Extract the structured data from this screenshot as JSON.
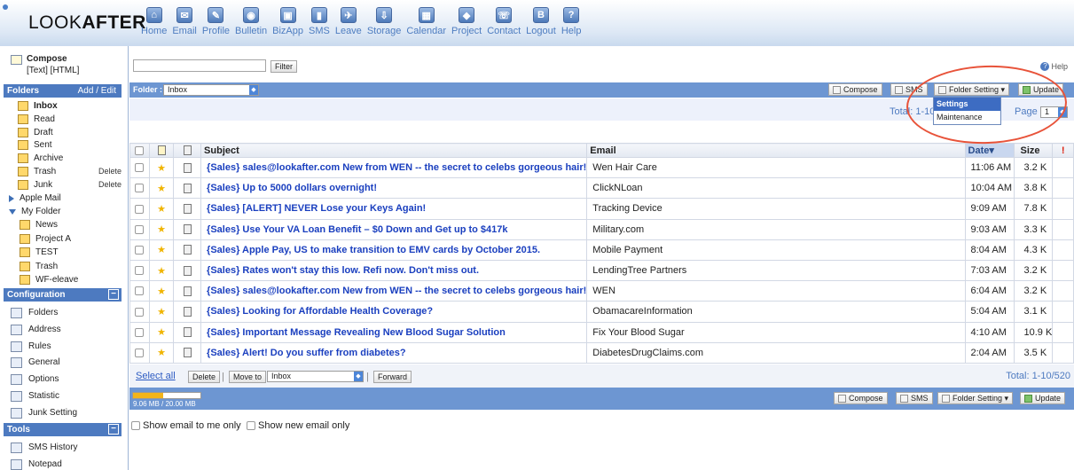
{
  "app": {
    "logo_plain": "LOOK",
    "logo_bold": "AFTER"
  },
  "nav": [
    {
      "label": "Home",
      "icon": "home-icon",
      "glyph": "⌂"
    },
    {
      "label": "Email",
      "icon": "email-icon",
      "glyph": "✉"
    },
    {
      "label": "Profile",
      "icon": "profile-icon",
      "glyph": "✎"
    },
    {
      "label": "Bulletin",
      "icon": "bulletin-icon",
      "glyph": "◉"
    },
    {
      "label": "BizApp",
      "icon": "bizapp-icon",
      "glyph": "▣"
    },
    {
      "label": "SMS",
      "icon": "sms-icon",
      "glyph": "▮"
    },
    {
      "label": "Leave",
      "icon": "leave-icon",
      "glyph": "✈"
    },
    {
      "label": "Storage",
      "icon": "storage-icon",
      "glyph": "⇩"
    },
    {
      "label": "Calendar",
      "icon": "calendar-icon",
      "glyph": "▦"
    },
    {
      "label": "Project",
      "icon": "project-icon",
      "glyph": "◆"
    },
    {
      "label": "Contact",
      "icon": "contact-icon",
      "glyph": "☏"
    },
    {
      "label": "Logout",
      "icon": "logout-icon",
      "glyph": "B"
    },
    {
      "label": "Help",
      "icon": "help-icon",
      "glyph": "?"
    }
  ],
  "sidebar": {
    "compose": "Compose",
    "compose_sub": "[Text] [HTML]",
    "folders_title": "Folders",
    "folders_action": "Add / Edit",
    "folders": [
      {
        "label": "Inbox",
        "bold": true
      },
      {
        "label": "Read"
      },
      {
        "label": "Draft"
      },
      {
        "label": "Sent"
      },
      {
        "label": "Archive"
      },
      {
        "label": "Trash",
        "action": "Delete"
      },
      {
        "label": "Junk",
        "action": "Delete"
      }
    ],
    "apple_mail": "Apple Mail",
    "my_folder": "My Folder",
    "my_folders": [
      "News",
      "Project A",
      "TEST",
      "Trash",
      "WF-eleave"
    ],
    "config_title": "Configuration",
    "config_items": [
      "Folders",
      "Address",
      "Rules",
      "General",
      "Options",
      "Statistic",
      "Junk Setting"
    ],
    "tools_title": "Tools",
    "tools_items": [
      "SMS History",
      "Notepad"
    ],
    "collapse_glyph": "−"
  },
  "toolbar": {
    "filter_value": "",
    "filter_label": "Filter",
    "help_label": "Help",
    "folder_label": "Folder :",
    "folder_selected": "Inbox",
    "compose_label": "Compose",
    "sms_label": "SMS",
    "folder_setting_label": "Folder Setting ▾",
    "update_label": "Update",
    "total_label": "Total: 1-10",
    "page_label": "Page",
    "page_value": "1"
  },
  "dropdown": {
    "items": [
      "Settings",
      "Maintenance"
    ],
    "selected": "Settings"
  },
  "table": {
    "headers": {
      "subject": "Subject",
      "email": "Email",
      "date": "Date▾",
      "size": "Size",
      "flag": "!"
    },
    "rows": [
      {
        "subject": "{Sales} sales@lookafter.com New from WEN -- the secret to celebs gorgeous hair!",
        "email": "Wen Hair Care",
        "date": "11:06 AM",
        "size": "3.2 K"
      },
      {
        "subject": "{Sales} Up to 5000 dollars overnight!",
        "email": "ClickNLoan",
        "date": "10:04 AM",
        "size": "3.8 K"
      },
      {
        "subject": "{Sales} [ALERT] NEVER Lose your Keys Again!",
        "email": "Tracking Device",
        "date": "9:09 AM",
        "size": "7.8 K"
      },
      {
        "subject": "{Sales} Use Your VA Loan Benefit – $0 Down and Get up to $417k",
        "email": "Military.com",
        "date": "9:03 AM",
        "size": "3.3 K"
      },
      {
        "subject": "{Sales} Apple Pay, US to make transition to EMV cards by October 2015.",
        "email": "Mobile Payment",
        "date": "8:04 AM",
        "size": "4.3 K"
      },
      {
        "subject": "{Sales} Rates won't stay this low. Refi now. Don't miss out.",
        "email": "LendingTree Partners",
        "date": "7:03 AM",
        "size": "3.2 K"
      },
      {
        "subject": "{Sales} sales@lookafter.com New from WEN -- the secret to celebs gorgeous hair!",
        "email": "WEN",
        "date": "6:04 AM",
        "size": "3.2 K"
      },
      {
        "subject": "{Sales} Looking for Affordable Health Coverage?",
        "email": "ObamacareInformation",
        "date": "5:04 AM",
        "size": "3.1 K"
      },
      {
        "subject": "{Sales} Important Message Revealing New Blood Sugar Solution",
        "email": "Fix Your Blood Sugar",
        "date": "4:10 AM",
        "size": "10.9 K"
      },
      {
        "subject": "{Sales} Alert! Do you suffer from diabetes?",
        "email": "DiabetesDrugClaims.com",
        "date": "2:04 AM",
        "size": "3.5 K"
      }
    ]
  },
  "bottom": {
    "select_all": "Select all",
    "delete_label": "Delete",
    "move_to_label": "Move to",
    "move_target": "Inbox",
    "forward_label": "Forward",
    "total_label": "Total: 1-10/520",
    "storage_text": "9.06 MB / 20.00 MB",
    "storage_fraction": 0.453,
    "show_me_only": "Show email to me only",
    "show_new_only": "Show new email only"
  },
  "colors": {
    "accent": "#4d7ac0",
    "bar": "#6d96d2",
    "star": "#f0b400",
    "highlight_circle": "#e8533a"
  }
}
